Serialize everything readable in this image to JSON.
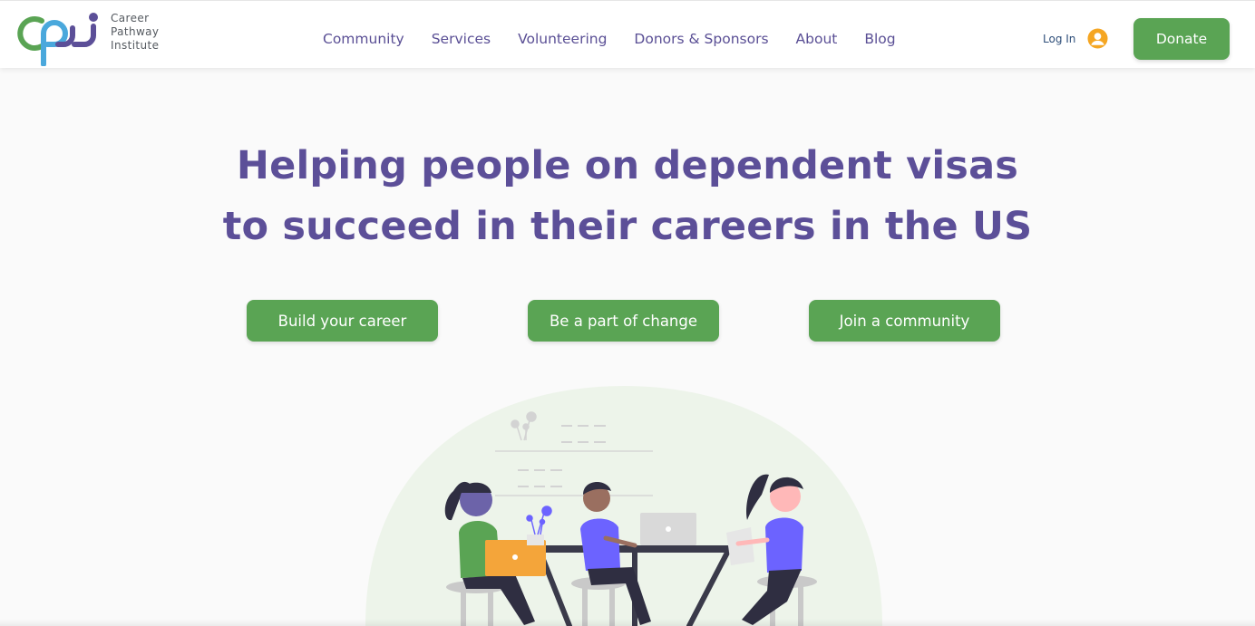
{
  "brand": {
    "name_lines": [
      "Career",
      "Pathway",
      "Institute"
    ],
    "logo_colors": {
      "green": "#5aa454",
      "blue": "#4aa8dc",
      "purple": "#5c4f98"
    }
  },
  "nav": {
    "links": [
      "Community",
      "Services",
      "Volunteering",
      "Donors & Sponsors",
      "About",
      "Blog"
    ],
    "login_label": "Log In",
    "user_icon": "user-circle-icon",
    "donate_label": "Donate"
  },
  "hero": {
    "title_lines": [
      "Helping people on dependent visas",
      "to succeed in their careers in the US"
    ],
    "buttons": [
      "Build your career",
      "Be a part of change",
      "Join a community"
    ]
  },
  "colors": {
    "accent_green": "#5aa454",
    "heading_purple": "#5c4f98",
    "illustration_bg": "#edf4ea"
  }
}
